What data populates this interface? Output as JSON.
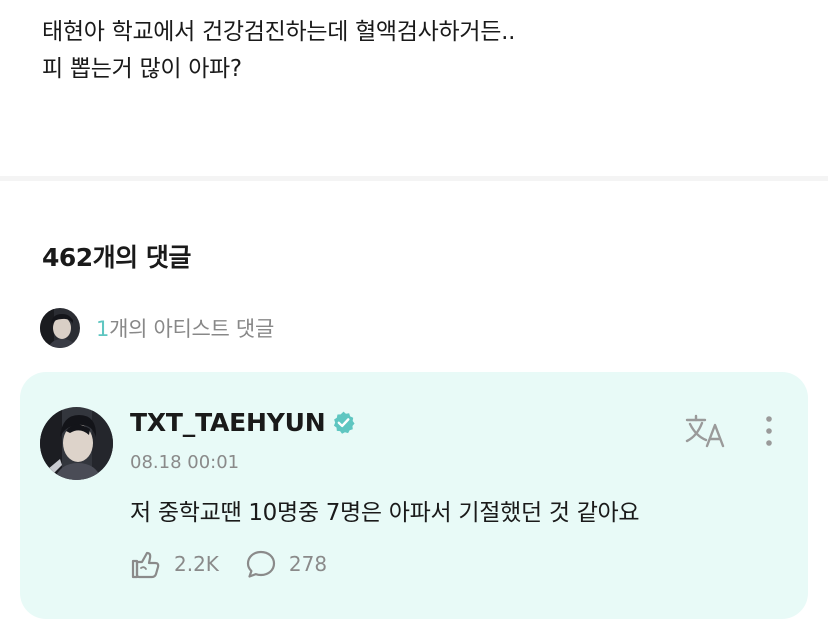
{
  "post": {
    "line1": "태현아 학교에서 건강검진하는데 혈액검사하거든..",
    "line2": "피 뽑는거 많이 아파?"
  },
  "comments": {
    "count_label": "462개의 댓글",
    "artist_count": "1",
    "artist_label": "개의 아티스트 댓글"
  },
  "comment": {
    "username": "TXT_TAEHYUN",
    "timestamp": "08.18 00:01",
    "text": "저 중학교땐 10명중 7명은 아파서 기절했던 것 같아요",
    "likes": "2.2K",
    "replies": "278"
  },
  "icons": {
    "verified": "verified-badge-icon",
    "translate": "translate-icon",
    "more": "more-vertical-icon",
    "like": "like-icon",
    "reply": "reply-bubble-icon"
  },
  "colors": {
    "accent": "#5fc6c1",
    "card_background": "#e8faf7",
    "muted_text": "#8a8a8a"
  }
}
